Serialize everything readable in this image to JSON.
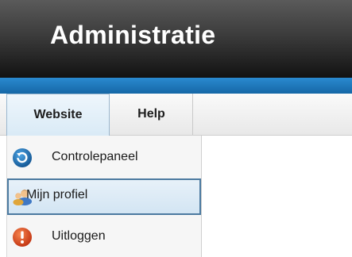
{
  "app": {
    "title": "Administratie"
  },
  "menu": {
    "tabs": [
      {
        "label": "Website"
      },
      {
        "label": "Help"
      }
    ]
  },
  "dropdown": {
    "items": [
      {
        "label": "Controlepaneel",
        "icon": "refresh-icon"
      },
      {
        "label": "Mijn profiel",
        "icon": "user-profile-icon"
      },
      {
        "label": "Uitloggen",
        "icon": "logout-icon"
      }
    ]
  },
  "colors": {
    "header_dark": "#121212",
    "accent_blue": "#1e7cc2",
    "highlight_border": "#4c7aa0",
    "logout_red": "#d9471f"
  }
}
